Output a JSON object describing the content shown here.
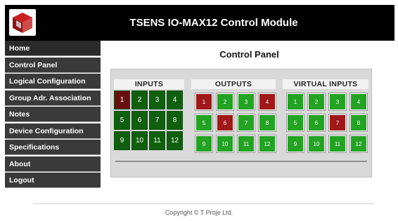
{
  "header": {
    "title": "TSENS IO-MAX12 Control Module"
  },
  "nav": [
    {
      "label": "Home"
    },
    {
      "label": "Control Panel"
    },
    {
      "label": "Logical Configuration"
    },
    {
      "label": "Group Adr. Association"
    },
    {
      "label": "Notes"
    },
    {
      "label": "Device Configuration"
    },
    {
      "label": "Specifications"
    },
    {
      "label": "About"
    },
    {
      "label": "Logout"
    }
  ],
  "page_title": "Control Panel",
  "colors": {
    "on_green": "#1f7a1f",
    "dark_green": "#0f5f0f",
    "bright_green": "#22a322",
    "red": "#a01818",
    "dark_red": "#6a0f0f"
  },
  "inputs": {
    "label": "INPUTS",
    "cells": [
      {
        "num": "1",
        "state": "active"
      },
      {
        "num": "2",
        "state": "idle"
      },
      {
        "num": "3",
        "state": "idle"
      },
      {
        "num": "4",
        "state": "idle"
      },
      {
        "num": "5",
        "state": "idle"
      },
      {
        "num": "6",
        "state": "idle"
      },
      {
        "num": "7",
        "state": "idle"
      },
      {
        "num": "8",
        "state": "idle"
      },
      {
        "num": "9",
        "state": "idle"
      },
      {
        "num": "10",
        "state": "idle"
      },
      {
        "num": "11",
        "state": "idle"
      },
      {
        "num": "12",
        "state": "idle"
      }
    ]
  },
  "outputs": {
    "label": "OUTPUTS",
    "cells": [
      {
        "num": "1",
        "state": "active"
      },
      {
        "num": "2",
        "state": "idle"
      },
      {
        "num": "3",
        "state": "idle"
      },
      {
        "num": "4",
        "state": "active"
      },
      {
        "num": "5",
        "state": "idle"
      },
      {
        "num": "6",
        "state": "active"
      },
      {
        "num": "7",
        "state": "idle"
      },
      {
        "num": "8",
        "state": "idle"
      },
      {
        "num": "9",
        "state": "idle"
      },
      {
        "num": "10",
        "state": "idle"
      },
      {
        "num": "11",
        "state": "idle"
      },
      {
        "num": "12",
        "state": "idle"
      }
    ]
  },
  "virtual_inputs": {
    "label": "VIRTUAL INPUTS",
    "cells": [
      {
        "num": "1",
        "state": "idle"
      },
      {
        "num": "2",
        "state": "idle"
      },
      {
        "num": "3",
        "state": "idle"
      },
      {
        "num": "4",
        "state": "idle"
      },
      {
        "num": "5",
        "state": "idle"
      },
      {
        "num": "6",
        "state": "idle"
      },
      {
        "num": "7",
        "state": "active"
      },
      {
        "num": "8",
        "state": "idle"
      },
      {
        "num": "9",
        "state": "idle"
      },
      {
        "num": "10",
        "state": "idle"
      },
      {
        "num": "11",
        "state": "idle"
      },
      {
        "num": "12",
        "state": "idle"
      }
    ]
  },
  "footer": {
    "copyright": "Copyright © T Proje Ltd."
  }
}
